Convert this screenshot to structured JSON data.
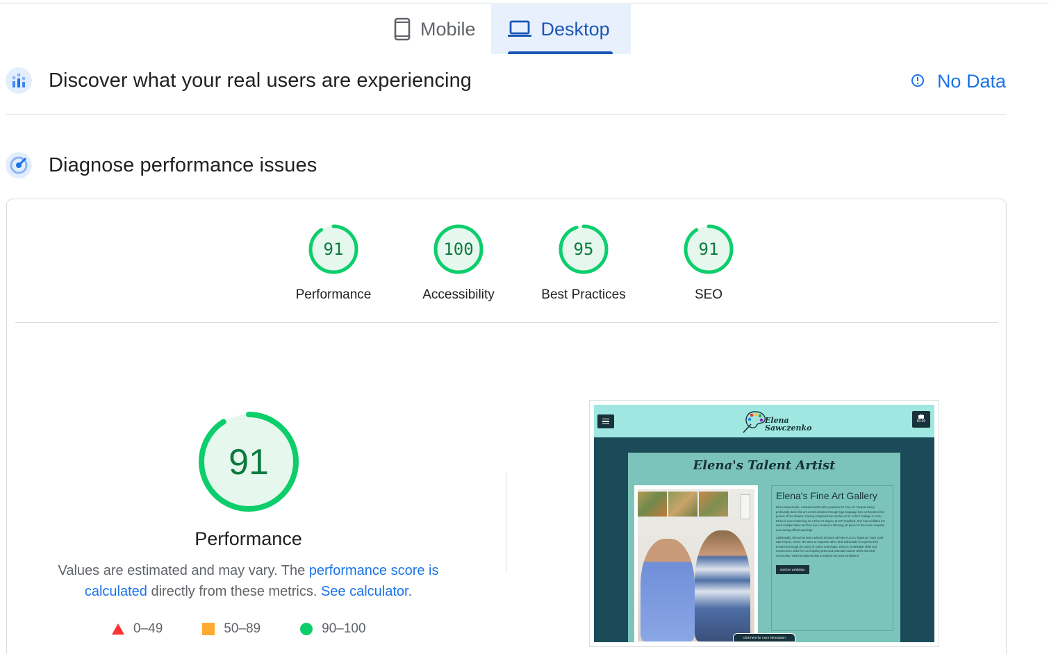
{
  "tabs": [
    {
      "label": "Mobile",
      "icon": "phone-icon",
      "active": false
    },
    {
      "label": "Desktop",
      "icon": "laptop-icon",
      "active": true
    }
  ],
  "field_data": {
    "title": "Discover what your real users are experiencing",
    "status": "No Data",
    "status_icon": "info-icon"
  },
  "lab": {
    "title": "Diagnose performance issues",
    "categories": [
      {
        "label": "Performance",
        "score": "91",
        "fraction": 0.91
      },
      {
        "label": "Accessibility",
        "score": "100",
        "fraction": 1.0
      },
      {
        "label": "Best Practices",
        "score": "95",
        "fraction": 0.95
      },
      {
        "label": "SEO",
        "score": "91",
        "fraction": 0.91
      }
    ],
    "main_score": {
      "label": "Performance",
      "score": "91",
      "fraction": 0.91
    },
    "description": {
      "text_before": "Values are estimated and may vary. The ",
      "link_score": "performance score is calculated",
      "text_middle": " directly from these metrics. ",
      "link_calc": "See calculator",
      "text_after": "."
    },
    "legend": [
      {
        "range": "0–49",
        "shape": "triangle",
        "color": "#ff3333"
      },
      {
        "range": "50–89",
        "shape": "square",
        "color": "#ffaa33"
      },
      {
        "range": "90–100",
        "shape": "circle",
        "color": "#0cce6b"
      }
    ]
  },
  "colors": {
    "pass_ring": "#0cce6b",
    "pass_fill": "#e6f7ee",
    "pass_text": "#0b7a3e",
    "accent": "#1a73e8",
    "tab_active": "#1a56b5"
  },
  "screenshot": {
    "logo_line1": "Elena",
    "logo_line2": "Sawczenko",
    "cart_text": "€0.00",
    "title": "Elena's Talent Artist",
    "heading": "Elena's Fine Art Gallery",
    "paragraph1": "Elena Sawczenko, a talented artist with a passion for Fine Art. Despite being profoundly deaf, Elena's communication through sign language has not hindered her pursuit of her dreams. Having completed her studies at St. John's College in Cork, Elena is now embarking on a Fine Art degree at CIT Crawford. She has exhibited her work multiple times and has even created a stunning art piece for the main reception area during official openings.",
    "paragraph2": "Additionally, Elena has been actively involved with the H.S.E's Tipperary Town Gold Star Project, where she aims to empower other deaf individuals to express their emotions through the purity of colour and shape. Elena's remarkable skills and experiences make her an inspiring artist and potential teacher within the deaf community. Visit the button below to explore her past exhibitions.",
    "visit_button": "visit her exhibition",
    "more_button": "Click here for more information"
  }
}
